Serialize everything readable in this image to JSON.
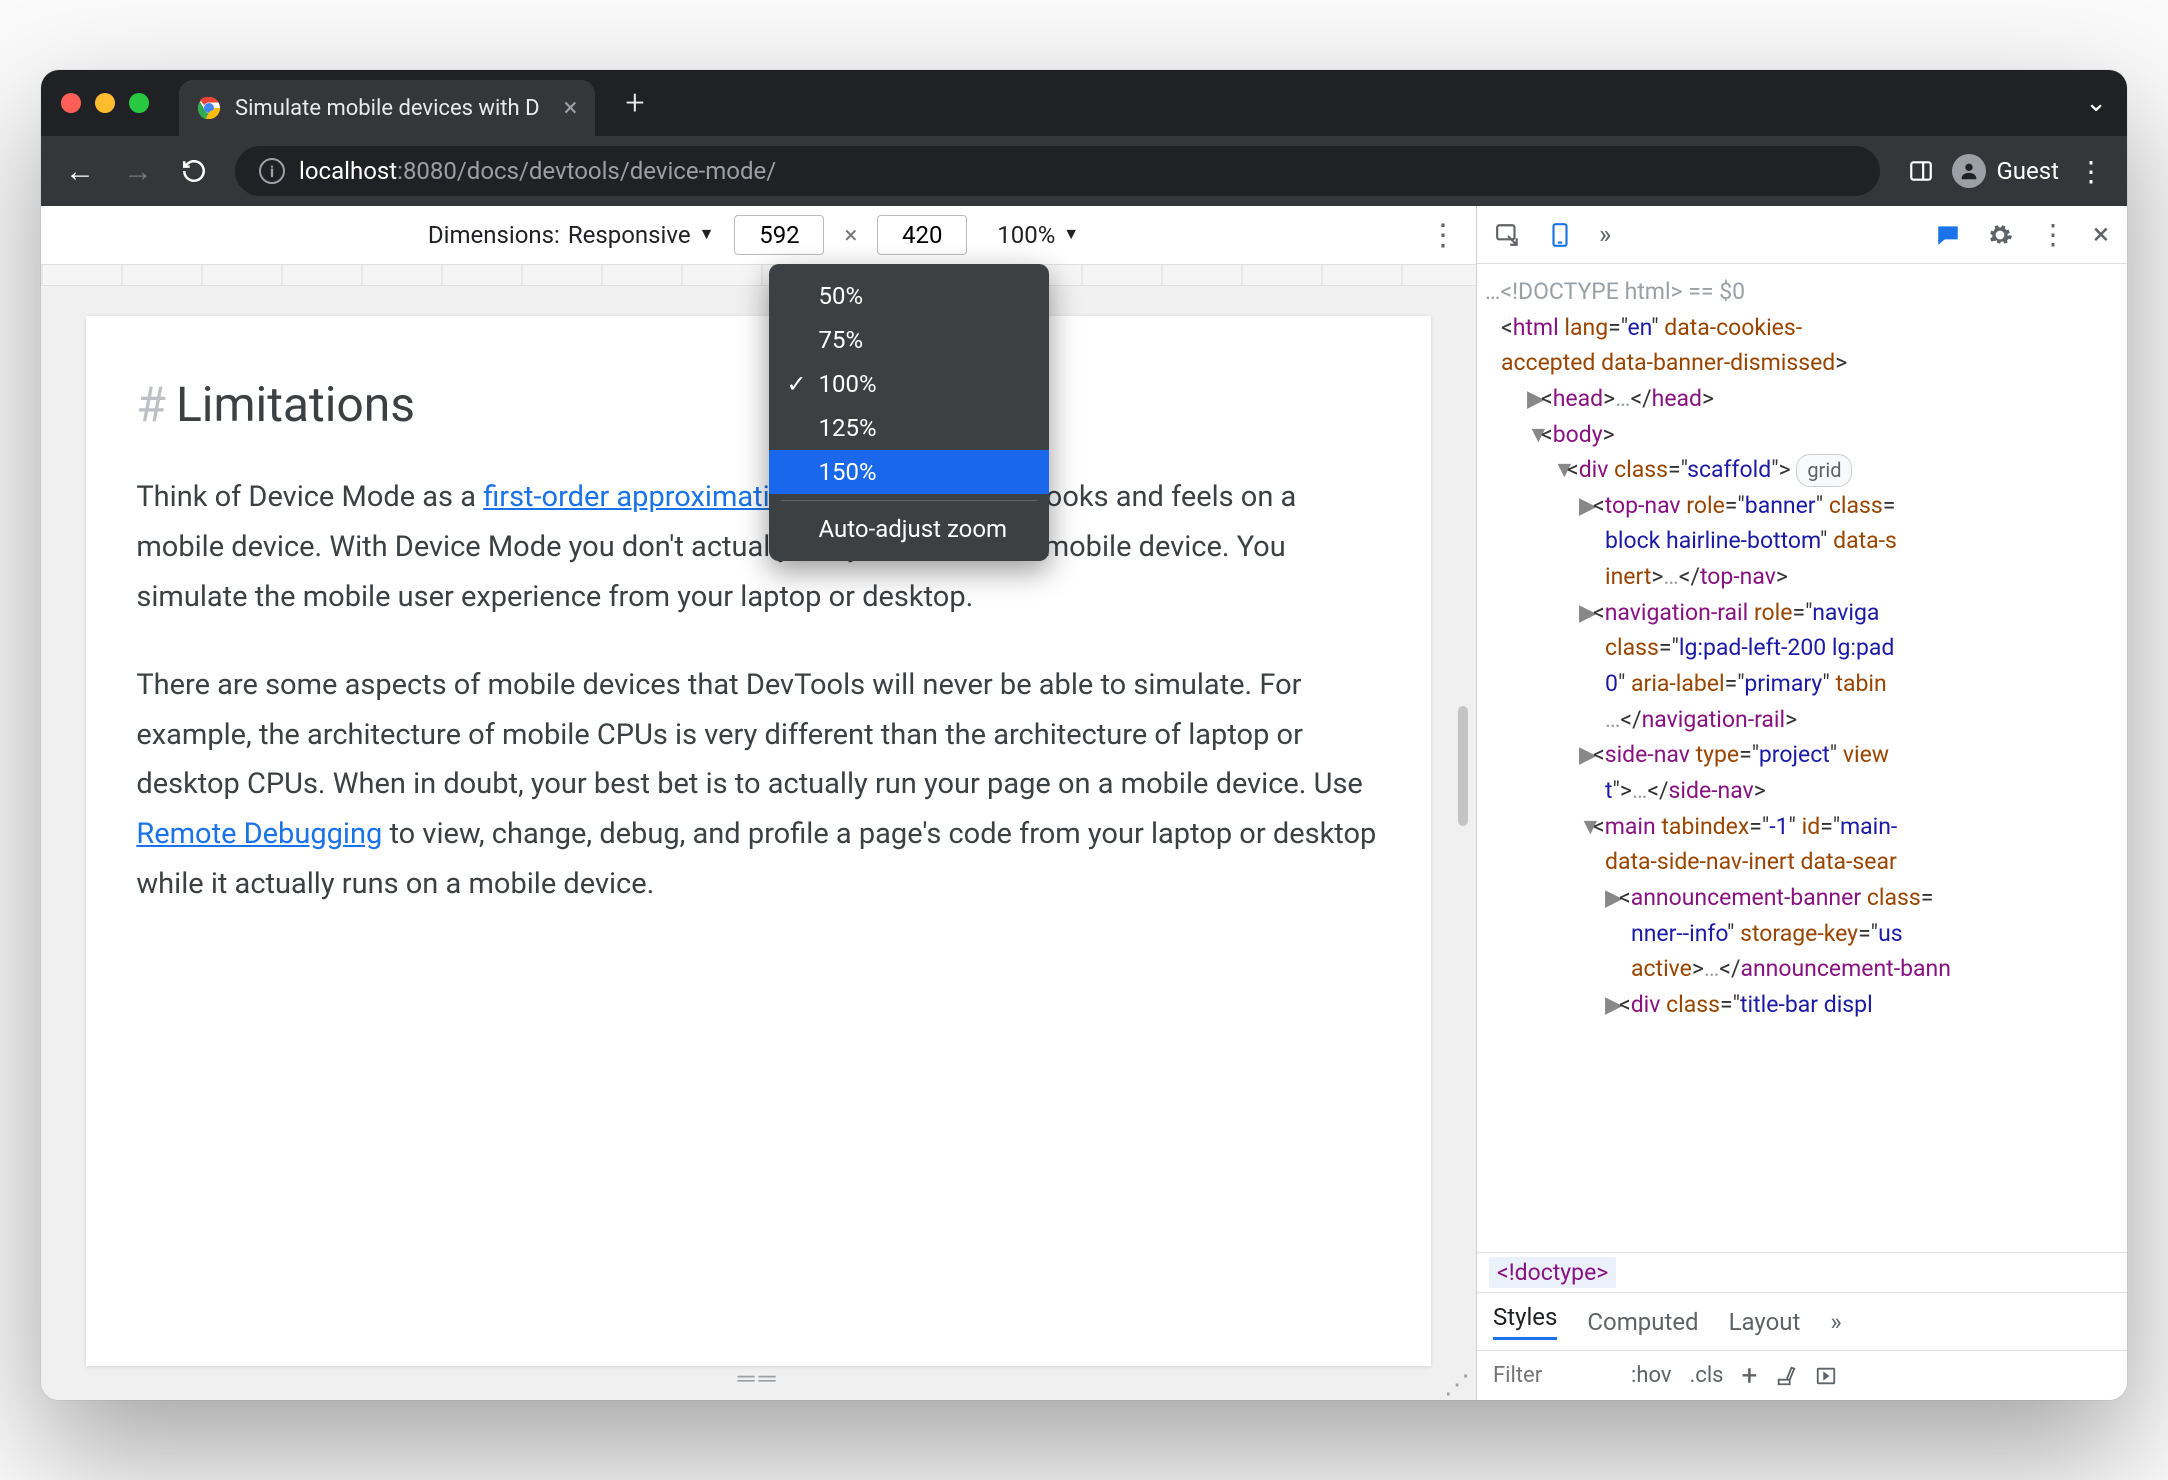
{
  "tab": {
    "title": "Simulate mobile devices with D"
  },
  "address": {
    "host": "localhost",
    "port": ":8080",
    "path": "/docs/devtools/device-mode/"
  },
  "guest_label": "Guest",
  "device_bar": {
    "dimensions_label": "Dimensions:",
    "preset": "Responsive",
    "width": "592",
    "height": "420",
    "multiply": "×",
    "zoom": "100%"
  },
  "zoom_menu": {
    "items": [
      "50%",
      "75%",
      "100%",
      "125%",
      "150%"
    ],
    "checked_index": 2,
    "selected_index": 4,
    "auto": "Auto-adjust zoom"
  },
  "page": {
    "heading": "Limitations",
    "hash": "#",
    "p1a": "Think of Device Mode as a ",
    "p1_link": "first-order approximation",
    "p1b": " of how your page looks and feels on a mobile device. With Device Mode you don't actually run your code on a mobile device. You simulate the mobile user experience from your laptop or desktop.",
    "p2a": "There are some aspects of mobile devices that DevTools will never be able to simulate. For example, the architecture of mobile CPUs is very different than the architecture of laptop or desktop CPUs. When in doubt, your best bet is to actually run your page on a mobile device. Use ",
    "p2_link": "Remote Debugging",
    "p2b": " to view, change, debug, and profile a page's code from your laptop or desktop while it actually runs on a mobile device."
  },
  "devtools": {
    "doctype": "<!DOCTYPE html>",
    "eq0": " == $0",
    "grid": "grid",
    "crumb": "<!doctype>",
    "styles_tabs": [
      "Styles",
      "Computed",
      "Layout"
    ],
    "filter_placeholder": "Filter",
    "hov": ":hov",
    "cls": ".cls",
    "plus": "+"
  },
  "icons": {
    "back": "←",
    "fwd": "→",
    "reload": "↻",
    "close": "×",
    "plus": "+",
    "chev": "⌄",
    "kebab": "⋮",
    "more": "»",
    "tri": "▼",
    "twr": "▶",
    "twd": "▼",
    "ell": "…"
  }
}
